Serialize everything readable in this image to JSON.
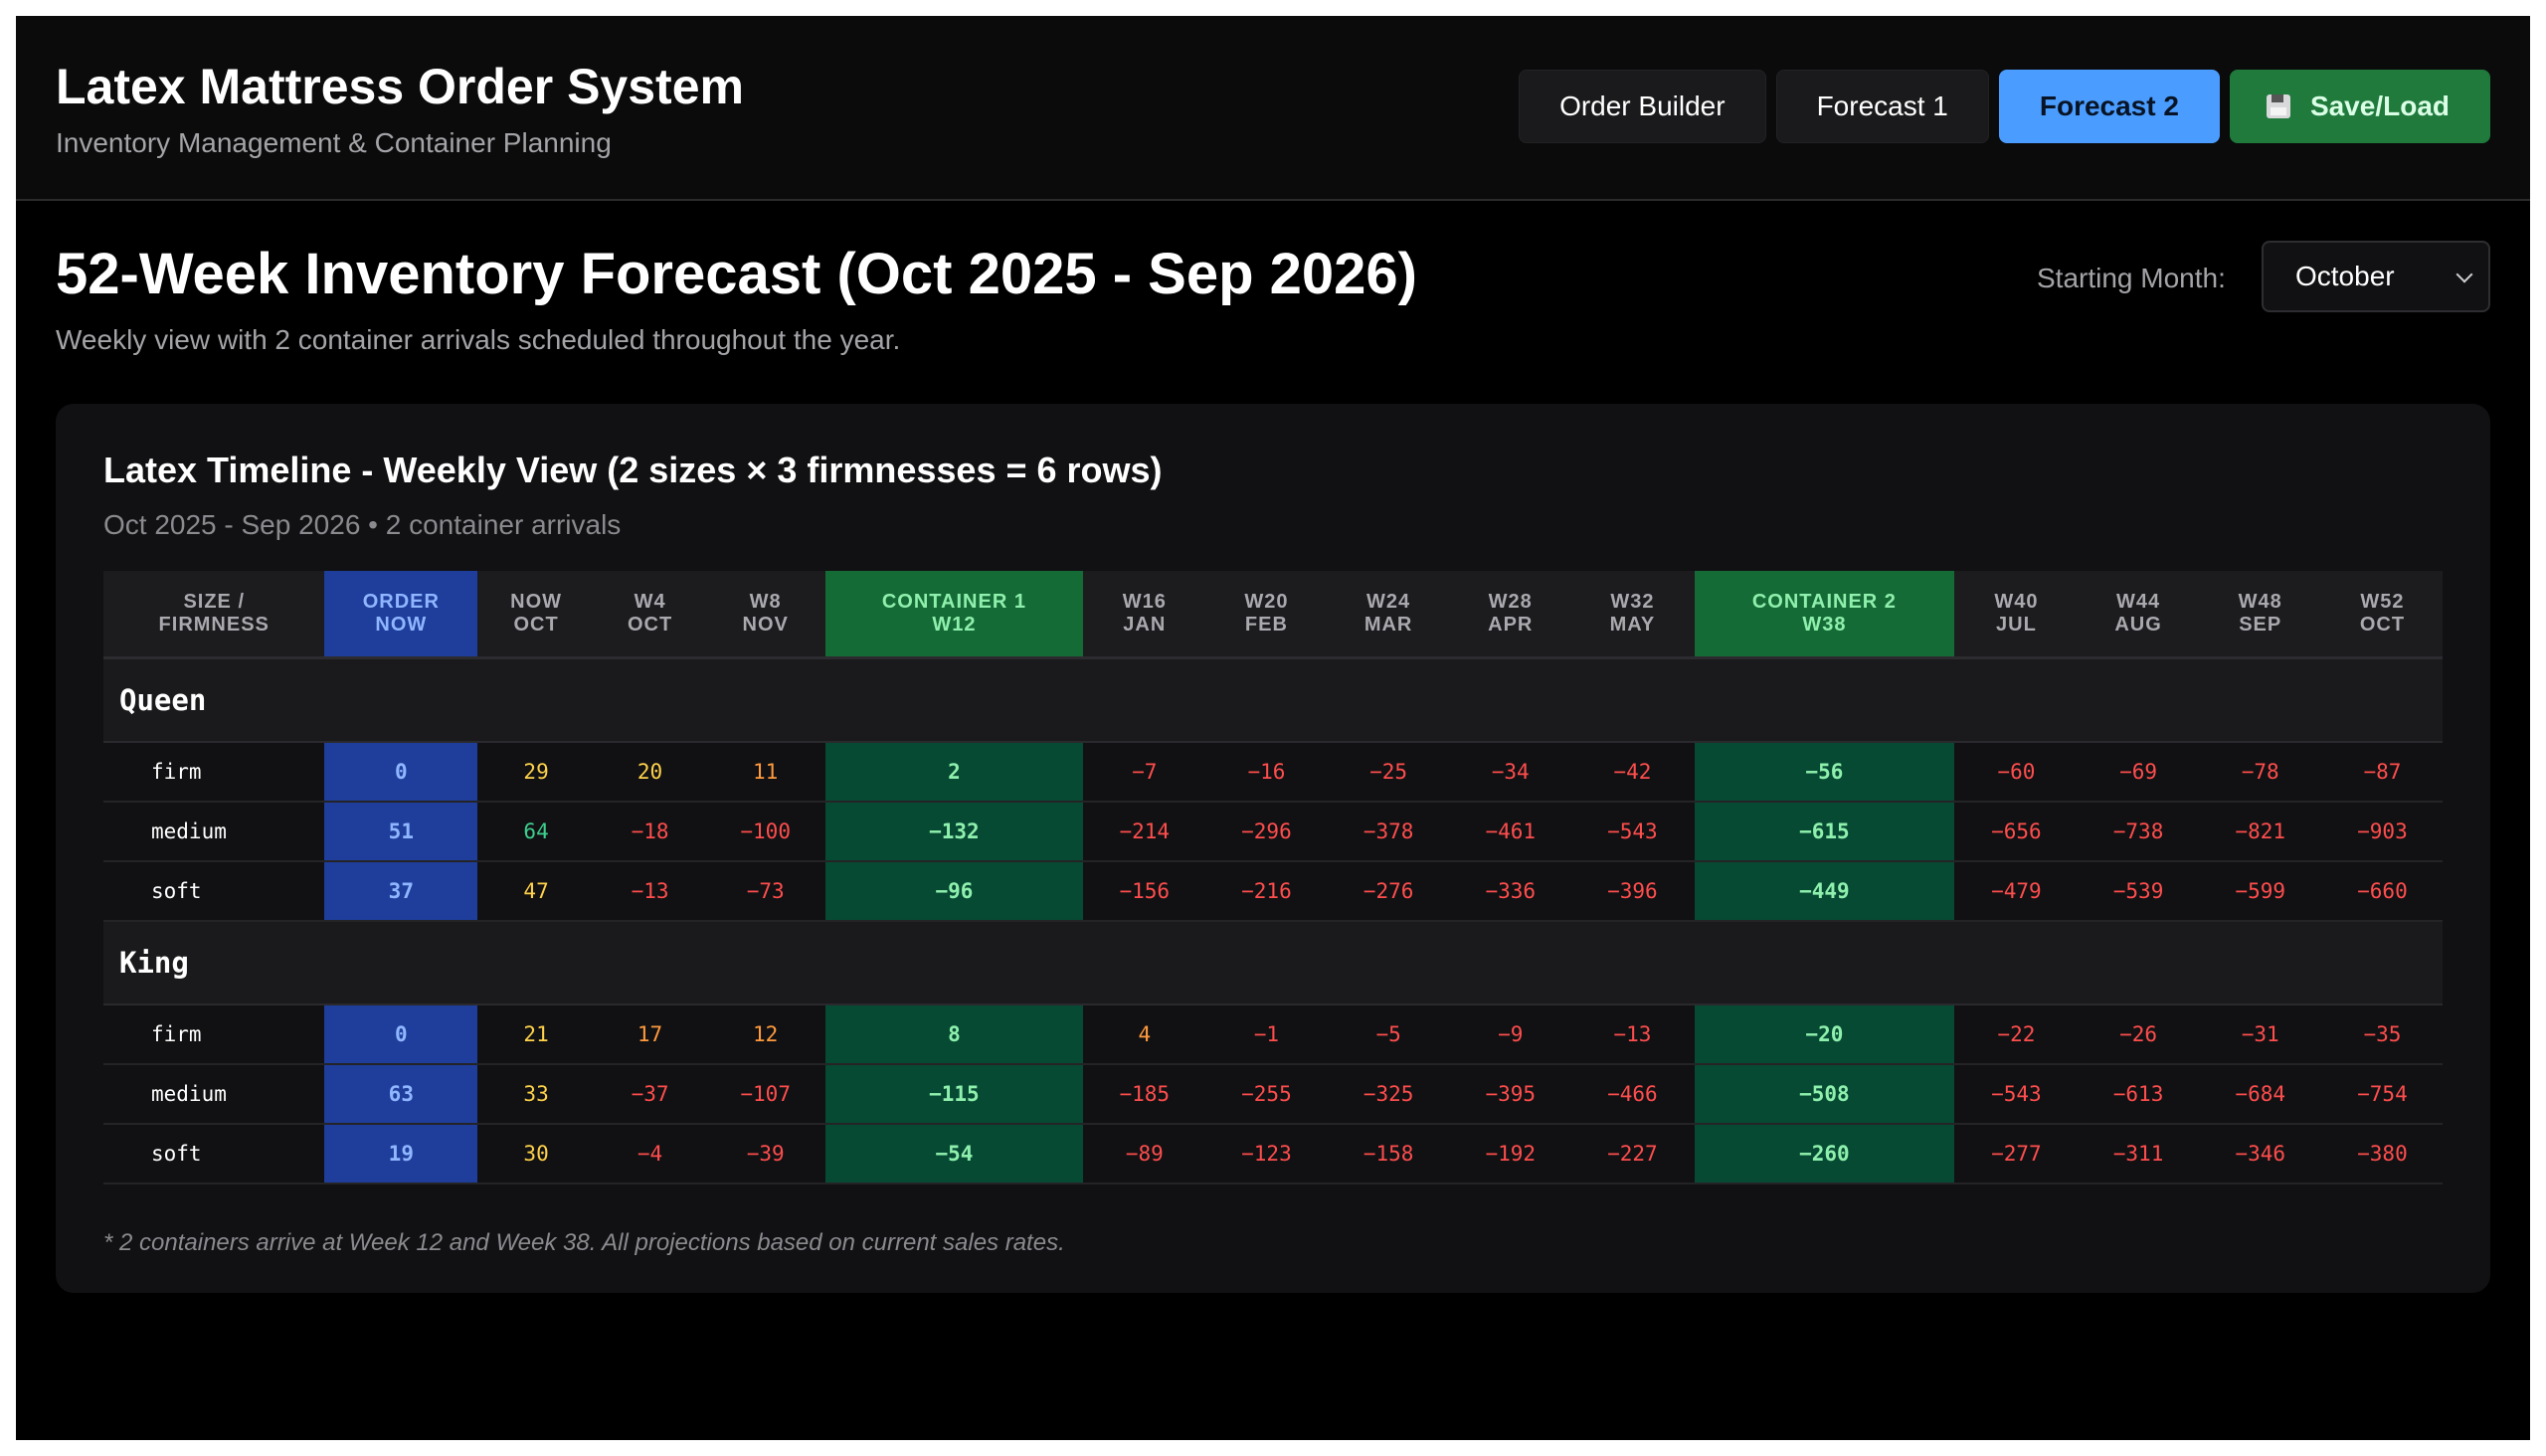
{
  "header": {
    "title": "Latex Mattress Order System",
    "subtitle": "Inventory Management & Container Planning",
    "nav": [
      {
        "label": "Order Builder",
        "active": false
      },
      {
        "label": "Forecast 1",
        "active": false
      },
      {
        "label": "Forecast 2",
        "active": true
      }
    ],
    "save_label": "Save/Load",
    "save_icon": "floppy-disk-icon"
  },
  "page": {
    "title": "52-Week Inventory Forecast (Oct 2025 - Sep 2026)",
    "description": "Weekly view with 2 container arrivals scheduled throughout the year.",
    "starting_month_label": "Starting Month:",
    "starting_month_value": "October"
  },
  "card": {
    "title": "Latex Timeline - Weekly View (2 sizes × 3 firmnesses = 6 rows)",
    "subtitle": "Oct 2025 - Sep 2026 • 2 container arrivals",
    "footnote": "* 2 containers arrive at Week 12 and Week 38. All projections based on current sales rates."
  },
  "table": {
    "columns": [
      {
        "label": "SIZE /\nFIRMNESS",
        "kind": "label"
      },
      {
        "label": "ORDER\nNOW",
        "kind": "order"
      },
      {
        "label": "NOW\nOCT",
        "kind": "week"
      },
      {
        "label": "W4\nOCT",
        "kind": "week"
      },
      {
        "label": "W8\nNOV",
        "kind": "week"
      },
      {
        "label": "CONTAINER 1\nW12",
        "kind": "container"
      },
      {
        "label": "W16\nJAN",
        "kind": "week"
      },
      {
        "label": "W20\nFEB",
        "kind": "week"
      },
      {
        "label": "W24\nMAR",
        "kind": "week"
      },
      {
        "label": "W28\nAPR",
        "kind": "week"
      },
      {
        "label": "W32\nMAY",
        "kind": "week"
      },
      {
        "label": "CONTAINER 2\nW38",
        "kind": "container"
      },
      {
        "label": "W40\nJUL",
        "kind": "week"
      },
      {
        "label": "W44\nAUG",
        "kind": "week"
      },
      {
        "label": "W48\nSEP",
        "kind": "week"
      },
      {
        "label": "W52\nOCT",
        "kind": "week"
      }
    ],
    "groups": [
      {
        "name": "Queen",
        "rows": [
          {
            "label": "firm",
            "order": "0",
            "values": [
              "29",
              "20",
              "11",
              "2",
              "-7",
              "-16",
              "-25",
              "-34",
              "-42",
              "-56",
              "-60",
              "-69",
              "-78",
              "-87"
            ]
          },
          {
            "label": "medium",
            "order": "51",
            "values": [
              "64",
              "-18",
              "-100",
              "-132",
              "-214",
              "-296",
              "-378",
              "-461",
              "-543",
              "-615",
              "-656",
              "-738",
              "-821",
              "-903"
            ]
          },
          {
            "label": "soft",
            "order": "37",
            "values": [
              "47",
              "-13",
              "-73",
              "-96",
              "-156",
              "-216",
              "-276",
              "-336",
              "-396",
              "-449",
              "-479",
              "-539",
              "-599",
              "-660"
            ]
          }
        ]
      },
      {
        "name": "King",
        "rows": [
          {
            "label": "firm",
            "order": "0",
            "values": [
              "21",
              "17",
              "12",
              "8",
              "4",
              "-1",
              "-5",
              "-9",
              "-13",
              "-20",
              "-22",
              "-26",
              "-31",
              "-35"
            ]
          },
          {
            "label": "medium",
            "order": "63",
            "values": [
              "33",
              "-37",
              "-107",
              "-115",
              "-185",
              "-255",
              "-325",
              "-395",
              "-466",
              "-508",
              "-543",
              "-613",
              "-684",
              "-754"
            ]
          },
          {
            "label": "soft",
            "order": "19",
            "values": [
              "30",
              "-4",
              "-39",
              "-54",
              "-89",
              "-123",
              "-158",
              "-192",
              "-227",
              "-260",
              "-277",
              "-311",
              "-346",
              "-380"
            ]
          }
        ]
      }
    ]
  },
  "colors": {
    "accent_blue": "#4a9dff",
    "save_green": "#1f7a3c",
    "order_column": "#1f3d9b",
    "container_column": "#064a33",
    "negative": "#ff4d4d",
    "low": "#ff9a3d",
    "medium": "#ffd24a",
    "good": "#3ecf8e"
  }
}
